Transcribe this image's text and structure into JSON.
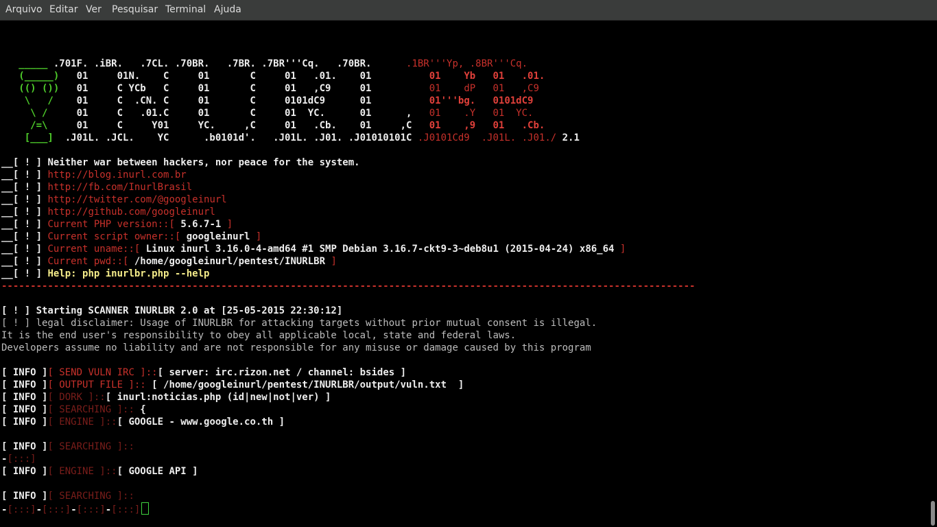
{
  "menubar": {
    "items": [
      "Arquivo",
      "Editar",
      "Ver",
      "Pesquisar",
      "Terminal",
      "Ajuda"
    ]
  },
  "colors": {
    "background": "#000000",
    "menubar": "#3a3c3b",
    "red": "#c8312b",
    "green": "#4fcf2b",
    "yellow": "#f5ec8a"
  },
  "banner": {
    "rows": [
      {
        "g": "   _____",
        "w": " .701F. .iBR.   .7CL. .70BR.   .7BR. .7BR'''Cq.   .70BR.",
        "r": "      .1BR'''Yp, .8BR'''Cq."
      },
      {
        "g": "   (_____)",
        "w": "   01     01N.    C     01       C     01   .01.    01",
        "r": "          01    Yb   01   .01."
      },
      {
        "g": "   (() ())",
        "w": "   01     C YCb   C     01       C     01   ,C9     01",
        "r": "          01    dP   01   ,C9"
      },
      {
        "g": "    \\   /",
        "w": "    01     C  .CN. C     01       C     0101dC9      01",
        "r": "          01'''bg.   0101dC9"
      },
      {
        "g": "     \\ /",
        "w": "     01     C   .01.C     01       C     01  YC.      01      ,",
        "r": "   01    .Y   01  YC."
      },
      {
        "g": "     /=\\",
        "w": "     01     C     Y01     YC.     ,C     01   .Cb.    01     ,C",
        "r": "   01    ,9   01   .Cb."
      },
      {
        "g": "    [___]",
        "w": "  .J01L. .JCL.    YC      .b0101d'.   .J01L. .J01. .J01010101C",
        "r": " .J0101Cd9  .J01L. .J01./",
        "v": " 2.1"
      }
    ]
  },
  "info_lines": {
    "prefix": "__[ ! ] ",
    "motto": "Neither war between hackers, nor peace for the system.",
    "links": [
      "http://blog.inurl.com.br",
      "http://fb.com/InurlBrasil",
      "http://twitter.com/@googleinurl",
      "http://github.com/googleinurl"
    ],
    "php_label": "Current PHP version::[ ",
    "php_value": "5.6.7-1",
    "owner_label": "Current script owner::[ ",
    "owner_value": "googleinurl",
    "uname_label": "Current uname::[ ",
    "uname_value": "Linux inurl 3.16.0-4-amd64 #1 SMP Debian 3.16.7-ckt9-3~deb8u1 (2015-04-24) x86_64",
    "pwd_label": "Current pwd::[ ",
    "pwd_value": "/home/googleinurl/pentest/INURLBR",
    "close": " ]",
    "help": "Help: php inurlbr.php --help"
  },
  "divider": "------------------------------------------------------------------------------------------------------------------------",
  "scanner": {
    "start": "[ ! ] Starting SCANNER INURLBR 2.0 at [25-05-2015 22:30:12]",
    "disclaimer": [
      "[ ! ] legal disclaimer: Usage of INURLBR for attacking targets without prior mutual consent is illegal.",
      "It is the end user's responsibility to obey all applicable local, state and federal laws.",
      "Developers assume no liability and are not responsible for any misuse or damage caused by this program"
    ]
  },
  "log": {
    "info": "[ INFO ]",
    "irc_label": "[ SEND VULN IRC ]::",
    "irc_value": "[ server: irc.rizon.net / channel: bsides ]",
    "output_label": "[ OUTPUT FILE ]::",
    "output_value": " [ /home/googleinurl/pentest/INURLBR/output/vuln.txt  ]",
    "dork_label": "[ DORK ]::",
    "dork_value": "[ inurl:noticias.php (id|new|not|ver) ]",
    "searching_label": "[ SEARCHING ]::",
    "searching_value": " {",
    "engine_label": "[ ENGINE ]::",
    "engine_value_1": "[ GOOGLE - www.google.co.th ]",
    "engine_value_2": "[ GOOGLE API ]",
    "dash": "-",
    "progress_token": "[:::]"
  }
}
